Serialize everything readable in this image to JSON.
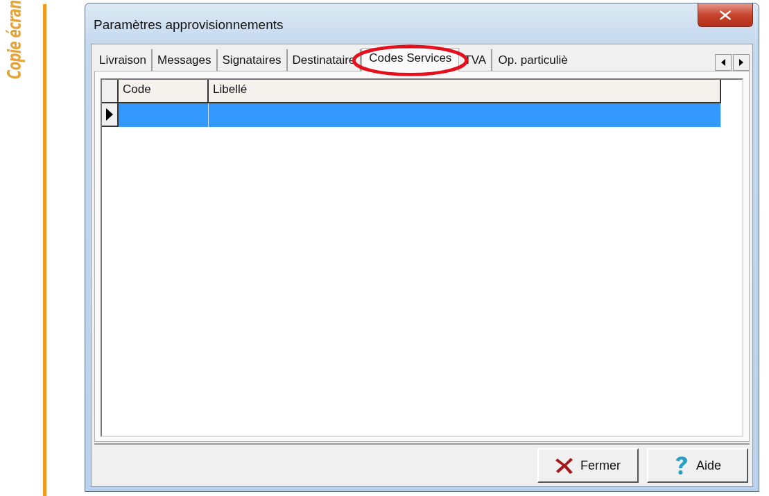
{
  "margin_label": "Copie écran",
  "window": {
    "title": "Paramètres approvisionnements"
  },
  "tabs": [
    {
      "label": "Livraison",
      "selected": false
    },
    {
      "label": "Messages",
      "selected": false
    },
    {
      "label": "Signataires",
      "selected": false
    },
    {
      "label": "Destinataire",
      "selected": false
    },
    {
      "label": "Codes Services",
      "selected": true
    },
    {
      "label": "TVA",
      "selected": false
    },
    {
      "label": "Op. particuliè",
      "selected": false
    }
  ],
  "table": {
    "columns": [
      "Code",
      "Libellé"
    ],
    "rows": [
      {
        "selected": true
      }
    ]
  },
  "buttons": [
    {
      "label": "Fermer",
      "kind": "close"
    },
    {
      "label": "Aide",
      "kind": "help"
    }
  ]
}
